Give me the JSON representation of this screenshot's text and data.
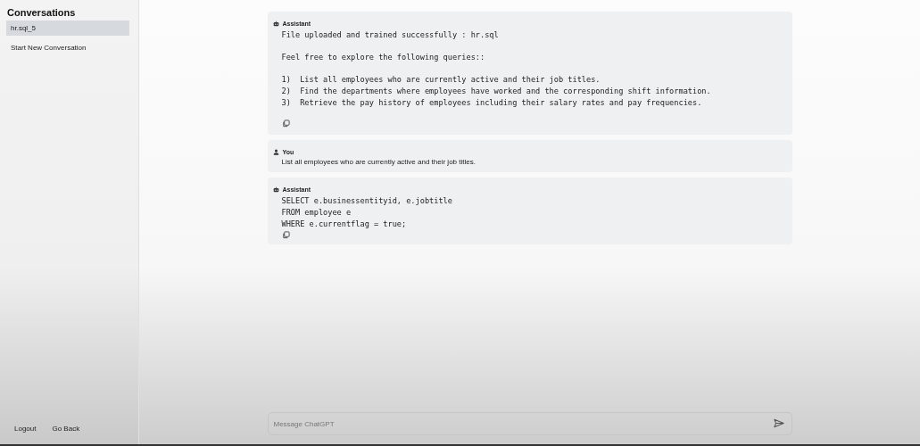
{
  "sidebar": {
    "title": "Conversations",
    "conversations": [
      {
        "label": "hr.sql_5",
        "selected": true
      }
    ],
    "new_conversation": "Start New Conversation",
    "footer_links": [
      "Logout",
      "Go Back"
    ]
  },
  "messages": [
    {
      "kind": "assistant",
      "author": "Assistant",
      "paragraphs": [
        [
          "File uploaded and trained successfully : hr.sql"
        ],
        [
          "Feel free to explore the following queries::"
        ],
        [
          "1)  List all employees who are currently active and their job titles.",
          "2)  Find the departments where employees have worked and the corresponding shift information.",
          "3)  Retrieve the pay history of employees including their salary rates and pay frequencies."
        ]
      ],
      "copy": true
    },
    {
      "kind": "user",
      "author": "You",
      "paragraphs": [
        [
          "List all employees who are currently active and their job titles."
        ]
      ],
      "copy": false
    },
    {
      "kind": "assistant",
      "author": "Assistant",
      "paragraphs": [
        [
          "SELECT e.businessentityid, e.jobtitle",
          "FROM employee e",
          "WHERE e.currentflag = true;"
        ]
      ],
      "copy": true
    }
  ],
  "composer": {
    "placeholder": "Message ChatGPT"
  }
}
